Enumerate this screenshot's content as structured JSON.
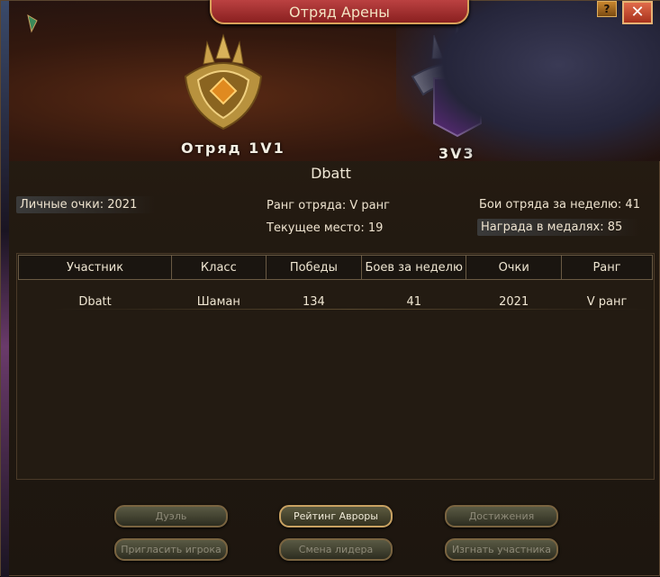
{
  "window": {
    "title": "Отряд Арены",
    "help": "?",
    "close": "✕"
  },
  "teams": [
    {
      "label": "Отряд 1V1"
    },
    {
      "label": "3V3"
    }
  ],
  "team_name": "Dbatt",
  "info": {
    "personal_points_label": "Личные очки:",
    "personal_points_value": "2021",
    "rank_label": "Ранг отряда:",
    "rank_value": "V ранг",
    "place_label": "Текущее место:",
    "place_value": "19",
    "weekly_battles_label": "Бои отряда за неделю:",
    "weekly_battles_value": "41",
    "medal_reward_label": "Награда в медалях:",
    "medal_reward_value": "85"
  },
  "table": {
    "headers": [
      "Участник",
      "Класс",
      "Победы",
      "Боев за неделю",
      "Очки",
      "Ранг"
    ],
    "rows": [
      [
        "Dbatt",
        "Шаман",
        "134",
        "41",
        "2021",
        "V ранг"
      ]
    ]
  },
  "buttons": {
    "duel": "Дуэль",
    "aurora_rating": "Рейтинг Авроры",
    "achievements": "Достижения",
    "invite": "Пригласить игрока",
    "change_leader": "Смена лидера",
    "kick": "Изгнать участника"
  },
  "colors": {
    "accent_gold": "#c9a262",
    "title_red": "#c44848",
    "close_red": "#d04a30",
    "emblem_purple": "#6a2a8a"
  }
}
